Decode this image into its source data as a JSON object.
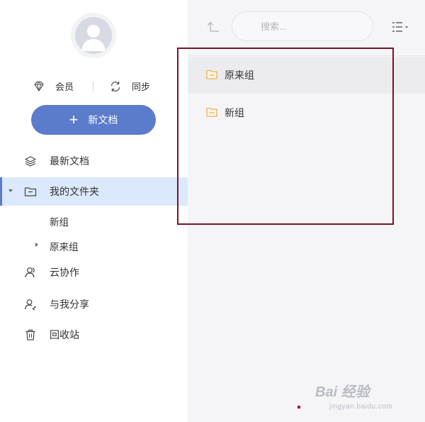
{
  "sidebar": {
    "member_label": "会员",
    "sync_label": "同步",
    "new_doc_label": "新文档",
    "recent_label": "最新文档",
    "my_folders_label": "我的文件夹",
    "sub_folders": [
      {
        "label": "新组"
      },
      {
        "label": "原来组"
      }
    ],
    "cloud_collab_label": "云协作",
    "shared_with_me_label": "与我分享",
    "recycle_bin_label": "回收站"
  },
  "toolbar": {
    "search_placeholder": "搜索..."
  },
  "folders": [
    {
      "label": "原来组",
      "selected": true
    },
    {
      "label": "新组",
      "selected": false
    }
  ],
  "watermark": {
    "main": "Bai 经验",
    "sub": "jingyan.baidu.com"
  },
  "colors": {
    "accent": "#5b7bcb",
    "active_bg": "#dce8fb",
    "folder_icon": "#e8a33b",
    "highlight_border": "#7b1226"
  },
  "icons": {
    "member": "diamond-icon",
    "sync": "sync-icon",
    "recent": "layers-icon",
    "my_folders": "folder-icon",
    "cloud_collab": "user-collab-icon",
    "shared": "user-share-icon",
    "recycle": "trash-icon",
    "up": "up-level-icon",
    "view": "list-view-icon"
  }
}
